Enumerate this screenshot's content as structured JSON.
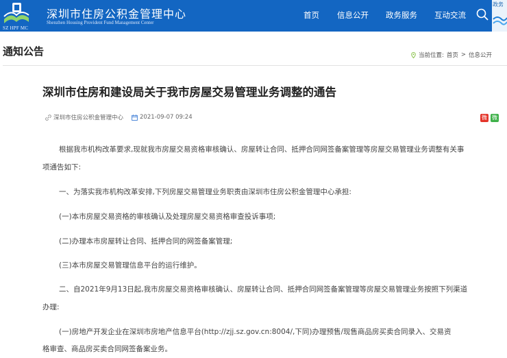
{
  "header": {
    "logo_abbr": "SZ HPF MC",
    "org_name_cn": "深圳市住房公积金管理中心",
    "org_name_en": "Shenzhen Housing Provident Fund Management Center",
    "nav": [
      "首页",
      "信息公开",
      "政务服务",
      "互动交流"
    ],
    "corner_badge": "政务"
  },
  "section": {
    "title": "通知公告",
    "breadcrumb_prefix": "当前位置:",
    "breadcrumb_items": [
      "首页",
      "信息公开"
    ],
    "breadcrumb_sep": ">"
  },
  "article": {
    "title": "深圳市住房和建设局关于我市房屋交易管理业务调整的通告",
    "source": "深圳市住房公积金管理中心",
    "date": "2021-09-07 09:24",
    "share_weibo": "微",
    "share_wechat": "微",
    "lines": [
      "根据我市机构改革要求,现就我市房屋交易资格审核确认、房屋转让合同、抵押合同网签备案管理等房屋交易管理业务调整有关事",
      "项通告如下:",
      "一、为落实我市机构改革安排,下列房屋交易管理业务职责由深圳市住房公积金管理中心承担:",
      "(一)本市房屋交易资格的审核确认及处理房屋交易资格审查投诉事项;",
      "(二)办理本市房屋转让合同、抵押合同的网签备案管理;",
      "(三)本市房屋交易管理信息平台的运行维护。",
      "二、自2021年9月13日起,我市房屋交易资格审核确认、房屋转让合同、抵押合同网签备案管理等房屋交易管理业务按照下列渠道",
      "办理:",
      "(一)房地产开发企业在深圳市房地产信息平台(http://zjj.sz.gov.cn:8004/,下同)办理预售/现售商品房买卖合同录入、交易资",
      "格审查、商品房买卖合同网签备案业务。"
    ]
  },
  "colors": {
    "header_bg": "#1366c2",
    "text": "#444444",
    "title": "#222222",
    "weibo": "#e4342a",
    "wechat": "#3fb14a"
  }
}
